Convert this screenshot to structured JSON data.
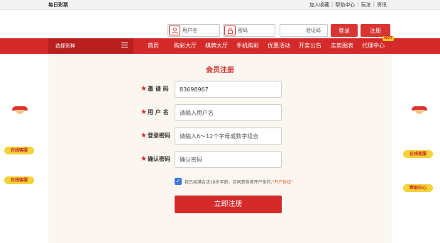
{
  "topbar": {
    "brand": "每日彩票",
    "links": [
      "加入收藏",
      "帮助中心",
      "玩法",
      "资讯"
    ]
  },
  "login": {
    "username_placeholder": "用户名",
    "password_placeholder": "密码",
    "captcha_placeholder": "验证码",
    "login_label": "登录",
    "register_label": "注册"
  },
  "nav": {
    "pick_label": "选择彩种",
    "items": [
      "首页",
      "购彩大厅",
      "棋牌大厅",
      "手机购彩",
      "优惠活动",
      "开奖公告",
      "走势图表",
      "代理中心"
    ],
    "hot_badge": "HOT"
  },
  "form": {
    "title": "会员注册",
    "invite_label": "邀 请 码",
    "invite_value": "83698967",
    "username_label": "用 户 名",
    "username_placeholder": "请输入用户名",
    "password_label": "登录密码",
    "password_placeholder": "请输入6～12个字母或数字组合",
    "confirm_label": "确认密码",
    "confirm_placeholder": "确认密码",
    "agree_text": "我已经满合法18岁年龄，且同意各项开户条约,",
    "agree_link": "\"开户协议\"",
    "submit_label": "立即注册"
  },
  "side_left": [
    "在线客服",
    "在线客服"
  ],
  "side_right": [
    "在线客服",
    "帮助中心"
  ],
  "colors": {
    "primary": "#d52a2a",
    "panel_bg": "#fbf6ef",
    "pill": "#f4d23a"
  }
}
